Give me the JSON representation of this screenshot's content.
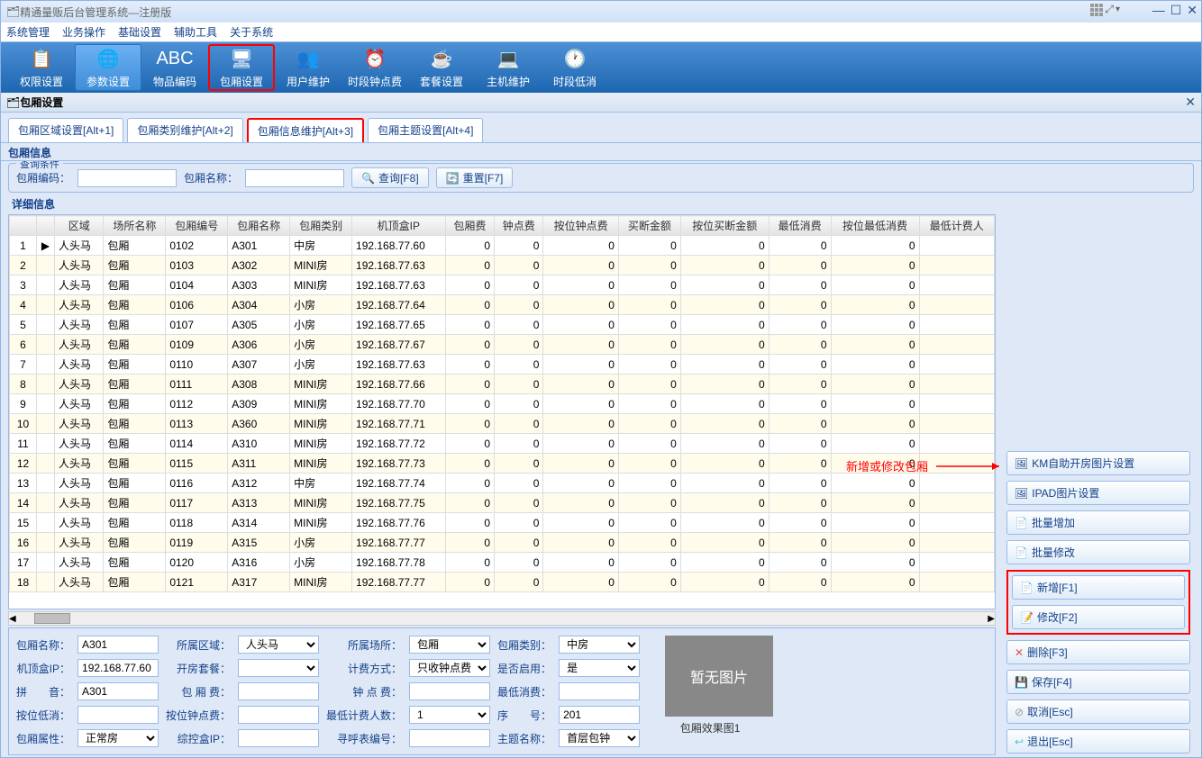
{
  "window": {
    "title": "精通量贩后台管理系统—注册版"
  },
  "menu": [
    "系统管理",
    "业务操作",
    "基础设置",
    "辅助工具",
    "关于系统"
  ],
  "toolbar": [
    {
      "label": "权限设置",
      "icon": "📋"
    },
    {
      "label": "参数设置",
      "icon": "🌐",
      "active": true
    },
    {
      "label": "物品编码",
      "icon": "ABC"
    },
    {
      "label": "包厢设置",
      "icon": "🖥",
      "highlighted": true
    },
    {
      "label": "用户维护",
      "icon": "👥"
    },
    {
      "label": "时段钟点费",
      "icon": "⏰"
    },
    {
      "label": "套餐设置",
      "icon": "☕"
    },
    {
      "label": "主机维护",
      "icon": "💻"
    },
    {
      "label": "时段低消",
      "icon": "🕐"
    }
  ],
  "subTitle": "包厢设置",
  "tabs": [
    {
      "label": "包厢区域设置[Alt+1]"
    },
    {
      "label": "包厢类别维护[Alt+2]"
    },
    {
      "label": "包厢信息维护[Alt+3]",
      "red": true
    },
    {
      "label": "包厢主题设置[Alt+4]"
    }
  ],
  "section1": "包厢信息",
  "queryFieldset": "查询条件",
  "query": {
    "codeLabel": "包厢编码：",
    "nameLabel": "包厢名称：",
    "searchBtn": "查询[F8]",
    "resetBtn": "重置[F7]"
  },
  "section2": "详细信息",
  "columns": [
    "",
    "区域",
    "场所名称",
    "包厢编号",
    "包厢名称",
    "包厢类别",
    "机顶盒IP",
    "包厢费",
    "钟点费",
    "按位钟点费",
    "买断金额",
    "按位买断金额",
    "最低消费",
    "按位最低消费",
    "最低计费人"
  ],
  "rows": [
    {
      "n": 1,
      "ptr": "▶",
      "area": "人头马",
      "place": "包厢",
      "code": "0102",
      "name": "A301",
      "type": "中房",
      "ip": "192.168.77.60",
      "v": [
        0,
        0,
        0,
        0,
        0,
        0,
        0
      ]
    },
    {
      "n": 2,
      "area": "人头马",
      "place": "包厢",
      "code": "0103",
      "name": "A302",
      "type": "MINI房",
      "ip": "192.168.77.63",
      "v": [
        0,
        0,
        0,
        0,
        0,
        0,
        0
      ]
    },
    {
      "n": 3,
      "area": "人头马",
      "place": "包厢",
      "code": "0104",
      "name": "A303",
      "type": "MINI房",
      "ip": "192.168.77.63",
      "v": [
        0,
        0,
        0,
        0,
        0,
        0,
        0
      ]
    },
    {
      "n": 4,
      "area": "人头马",
      "place": "包厢",
      "code": "0106",
      "name": "A304",
      "type": "小房",
      "ip": "192.168.77.64",
      "v": [
        0,
        0,
        0,
        0,
        0,
        0,
        0
      ]
    },
    {
      "n": 5,
      "area": "人头马",
      "place": "包厢",
      "code": "0107",
      "name": "A305",
      "type": "小房",
      "ip": "192.168.77.65",
      "v": [
        0,
        0,
        0,
        0,
        0,
        0,
        0
      ]
    },
    {
      "n": 6,
      "area": "人头马",
      "place": "包厢",
      "code": "0109",
      "name": "A306",
      "type": "小房",
      "ip": "192.168.77.67",
      "v": [
        0,
        0,
        0,
        0,
        0,
        0,
        0
      ]
    },
    {
      "n": 7,
      "area": "人头马",
      "place": "包厢",
      "code": "0110",
      "name": "A307",
      "type": "小房",
      "ip": "192.168.77.63",
      "v": [
        0,
        0,
        0,
        0,
        0,
        0,
        0
      ]
    },
    {
      "n": 8,
      "area": "人头马",
      "place": "包厢",
      "code": "0111",
      "name": "A308",
      "type": "MINI房",
      "ip": "192.168.77.66",
      "v": [
        0,
        0,
        0,
        0,
        0,
        0,
        0
      ]
    },
    {
      "n": 9,
      "area": "人头马",
      "place": "包厢",
      "code": "0112",
      "name": "A309",
      "type": "MINI房",
      "ip": "192.168.77.70",
      "v": [
        0,
        0,
        0,
        0,
        0,
        0,
        0
      ]
    },
    {
      "n": 10,
      "area": "人头马",
      "place": "包厢",
      "code": "0113",
      "name": "A360",
      "type": "MINI房",
      "ip": "192.168.77.71",
      "v": [
        0,
        0,
        0,
        0,
        0,
        0,
        0
      ]
    },
    {
      "n": 11,
      "area": "人头马",
      "place": "包厢",
      "code": "0114",
      "name": "A310",
      "type": "MINI房",
      "ip": "192.168.77.72",
      "v": [
        0,
        0,
        0,
        0,
        0,
        0,
        0
      ]
    },
    {
      "n": 12,
      "area": "人头马",
      "place": "包厢",
      "code": "0115",
      "name": "A311",
      "type": "MINI房",
      "ip": "192.168.77.73",
      "v": [
        0,
        0,
        0,
        0,
        0,
        0,
        0
      ]
    },
    {
      "n": 13,
      "area": "人头马",
      "place": "包厢",
      "code": "0116",
      "name": "A312",
      "type": "中房",
      "ip": "192.168.77.74",
      "v": [
        0,
        0,
        0,
        0,
        0,
        0,
        0
      ]
    },
    {
      "n": 14,
      "area": "人头马",
      "place": "包厢",
      "code": "0117",
      "name": "A313",
      "type": "MINI房",
      "ip": "192.168.77.75",
      "v": [
        0,
        0,
        0,
        0,
        0,
        0,
        0
      ]
    },
    {
      "n": 15,
      "area": "人头马",
      "place": "包厢",
      "code": "0118",
      "name": "A314",
      "type": "MINI房",
      "ip": "192.168.77.76",
      "v": [
        0,
        0,
        0,
        0,
        0,
        0,
        0
      ]
    },
    {
      "n": 16,
      "area": "人头马",
      "place": "包厢",
      "code": "0119",
      "name": "A315",
      "type": "小房",
      "ip": "192.168.77.77",
      "v": [
        0,
        0,
        0,
        0,
        0,
        0,
        0
      ]
    },
    {
      "n": 17,
      "area": "人头马",
      "place": "包厢",
      "code": "0120",
      "name": "A316",
      "type": "小房",
      "ip": "192.168.77.78",
      "v": [
        0,
        0,
        0,
        0,
        0,
        0,
        0
      ]
    },
    {
      "n": 18,
      "area": "人头马",
      "place": "包厢",
      "code": "0121",
      "name": "A317",
      "type": "MINI房",
      "ip": "192.168.77.77",
      "v": [
        0,
        0,
        0,
        0,
        0,
        0,
        0
      ]
    }
  ],
  "sideButtons": {
    "km": "KM自助开房图片设置",
    "ipad": "IPAD图片设置",
    "batchAdd": "批量增加",
    "batchEdit": "批量修改",
    "add": "新增[F1]",
    "edit": "修改[F2]",
    "delete": "删除[F3]",
    "save": "保存[F4]",
    "cancel": "取消[Esc]",
    "exit": "退出[Esc]"
  },
  "annotation": "新增或修改包厢",
  "form": {
    "name": {
      "label": "包厢名称：",
      "value": "A301"
    },
    "area": {
      "label": "所属区域：",
      "value": "人头马"
    },
    "place": {
      "label": "所属场所：",
      "value": "包厢"
    },
    "type": {
      "label": "包厢类别：",
      "value": "中房"
    },
    "ip": {
      "label": "机顶盒IP：",
      "value": "192.168.77.60"
    },
    "openPkg": {
      "label": "开房套餐：",
      "value": ""
    },
    "calcType": {
      "label": "计费方式：",
      "value": "只收钟点费"
    },
    "enabled": {
      "label": "是否启用：",
      "value": "是"
    },
    "pinyin": {
      "label": "拼　　音：",
      "value": "A301"
    },
    "roomFee": {
      "label": "包 厢 费：",
      "value": ""
    },
    "hourFee": {
      "label": "钟 点 费：",
      "value": ""
    },
    "minCons": {
      "label": "最低消费：",
      "value": ""
    },
    "minSeat": {
      "label": "按位低消：",
      "value": ""
    },
    "seatHour": {
      "label": "按位钟点费：",
      "value": ""
    },
    "minPeople": {
      "label": "最低计费人数：",
      "value": "1"
    },
    "seq": {
      "label": "序　　号：",
      "value": "201"
    },
    "roomProp": {
      "label": "包厢属性：",
      "value": "正常房"
    },
    "ctrlIP": {
      "label": "综控盒IP：",
      "value": ""
    },
    "meterCode": {
      "label": "寻呼表编号：",
      "value": ""
    },
    "theme": {
      "label": "主题名称：",
      "value": "首层包钟"
    }
  },
  "imageBox": "暂无图片",
  "imageCaption": "包厢效果图1"
}
